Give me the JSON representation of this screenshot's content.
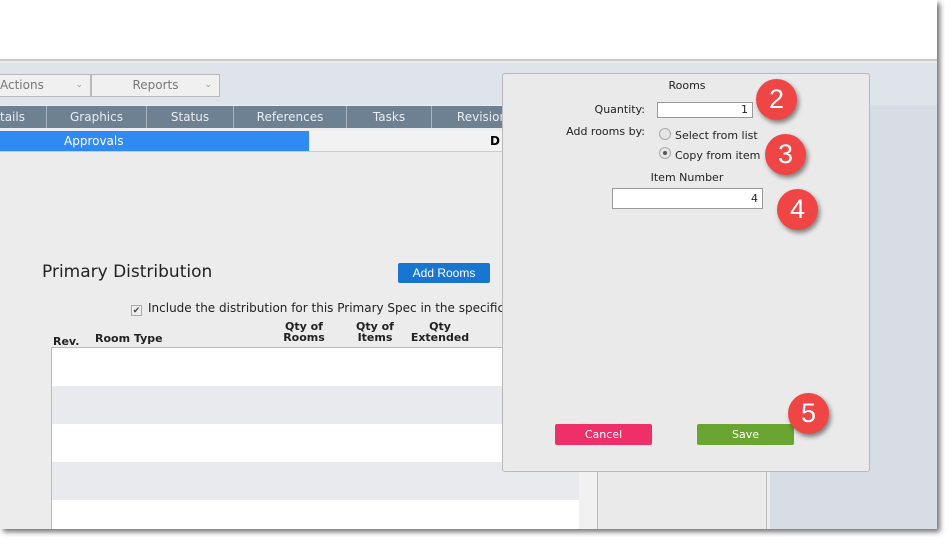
{
  "toolbar": {
    "actions": "Actions",
    "reports": "Reports"
  },
  "tabs": [
    "tails",
    "Graphics",
    "Status",
    "References",
    "Tasks",
    "Revision"
  ],
  "subtabs": {
    "active": "Approvals",
    "other": "D"
  },
  "section": {
    "title": "Primary Distribution",
    "add_rooms": "Add Rooms",
    "include_label": "Include the distribution for this Primary Spec in the specifications",
    "include_checked": true
  },
  "table": {
    "headers": {
      "rev": "Rev.",
      "room_type": "Room Type",
      "qty_rooms_1": "Qty of",
      "qty_rooms_2": "Rooms",
      "qty_items_1": "Qty of",
      "qty_items_2": "Items",
      "qty_ext_1": "Qty",
      "qty_ext_2": "Extended"
    }
  },
  "dialog": {
    "title": "Rooms",
    "quantity_label": "Quantity:",
    "quantity_value": "1",
    "add_by_label": "Add rooms by:",
    "option_list": "Select from list",
    "option_copy": "Copy from item",
    "selected_option": "Copy from item",
    "item_number_label": "Item Number",
    "item_number_value": "4",
    "cancel": "Cancel",
    "save": "Save"
  },
  "callouts": [
    "2",
    "3",
    "4",
    "5"
  ],
  "colors": {
    "tab_bar": "#6e8193",
    "active_subtab": "#2f8bf3",
    "add_rooms": "#1876d2",
    "cancel": "#ee2f6a",
    "save": "#6aa532",
    "callout": "#f04545"
  }
}
